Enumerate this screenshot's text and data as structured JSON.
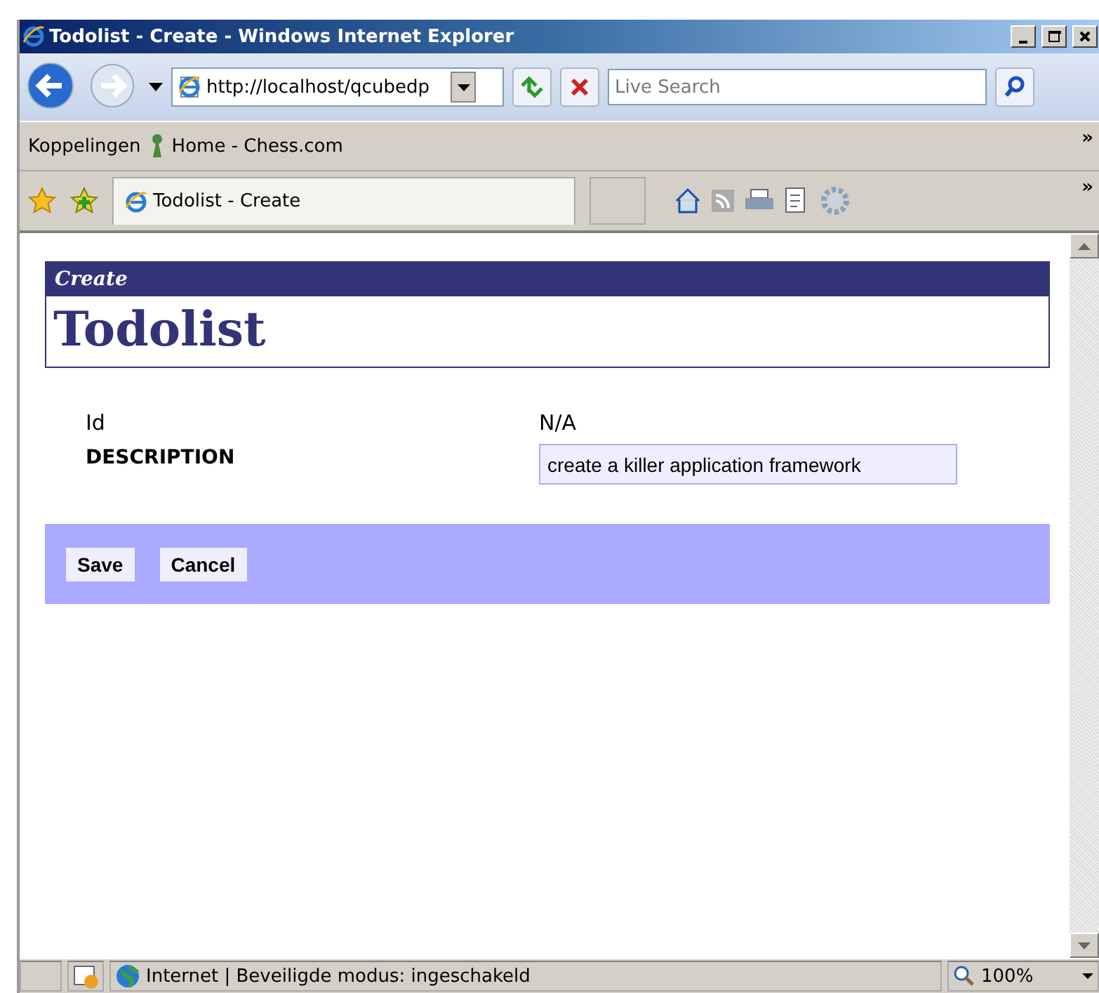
{
  "window": {
    "title": "Todolist - Create - Windows Internet Explorer"
  },
  "nav": {
    "url": "http://localhost/qcubedp",
    "search": {
      "placeholder": "Live Search"
    }
  },
  "links_bar": {
    "label": "Koppelingen",
    "links": [
      {
        "label": "Home - Chess.com"
      }
    ],
    "overflow": "»"
  },
  "tab_bar": {
    "tabs": [
      {
        "label": "Todolist - Create",
        "selected": true
      }
    ],
    "overflow": "»"
  },
  "page": {
    "subtitle": "Create",
    "heading": "Todolist",
    "fields": [
      {
        "kind": "text",
        "label": "Id",
        "value": "N/A"
      },
      {
        "kind": "input",
        "label": "DESCRIPTION",
        "value": "create a killer application framework"
      }
    ],
    "buttons": [
      "Save",
      "Cancel"
    ]
  },
  "status_bar": {
    "zone": "Internet | Beveiligde modus: ingeschakeld",
    "zoom": "100%"
  }
}
